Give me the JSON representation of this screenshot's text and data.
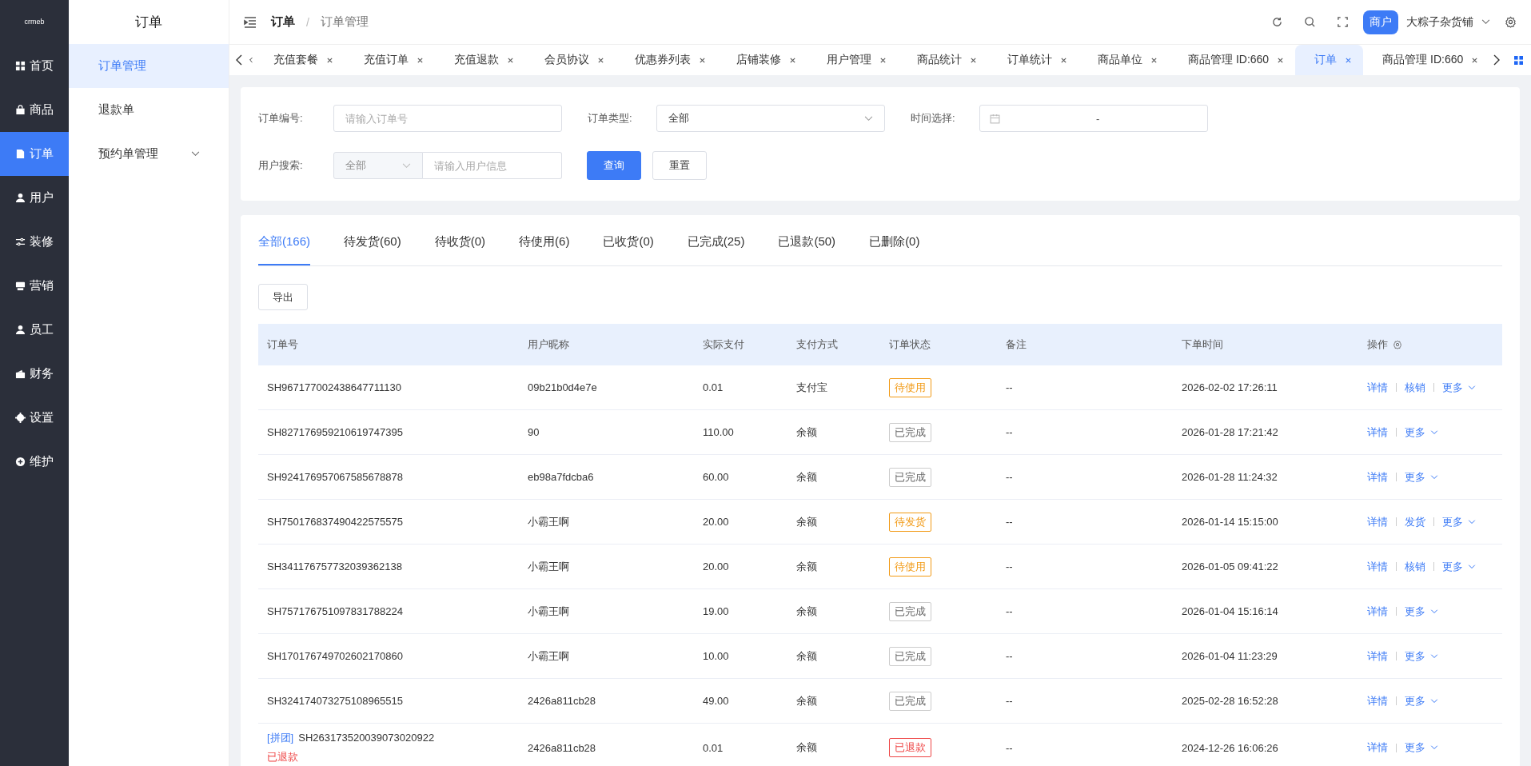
{
  "logo": "crmeb",
  "nav": [
    {
      "label": "首页",
      "selected": false
    },
    {
      "label": "商品",
      "selected": false
    },
    {
      "label": "订单",
      "selected": true
    },
    {
      "label": "用户",
      "selected": false
    },
    {
      "label": "装修",
      "selected": false
    },
    {
      "label": "营销",
      "selected": false
    },
    {
      "label": "员工",
      "selected": false
    },
    {
      "label": "财务",
      "selected": false
    },
    {
      "label": "设置",
      "selected": false
    },
    {
      "label": "维护",
      "selected": false
    }
  ],
  "submenu": {
    "title": "订单",
    "items": [
      {
        "label": "订单管理",
        "selected": true,
        "expandable": false
      },
      {
        "label": "退款单",
        "selected": false,
        "expandable": false
      },
      {
        "label": "预约单管理",
        "selected": false,
        "expandable": true
      }
    ]
  },
  "breadcrumb": [
    "订单",
    "订单管理"
  ],
  "breadcrumb_separator": "/",
  "header": {
    "role_badge": "商户",
    "shop": "大粽子杂货铺"
  },
  "page_tabs": [
    {
      "label": "充值套餐",
      "selected": false
    },
    {
      "label": "充值订单",
      "selected": false
    },
    {
      "label": "充值退款",
      "selected": false
    },
    {
      "label": "会员协议",
      "selected": false
    },
    {
      "label": "优惠券列表",
      "selected": false
    },
    {
      "label": "店铺装修",
      "selected": false
    },
    {
      "label": "用户管理",
      "selected": false
    },
    {
      "label": "商品统计",
      "selected": false
    },
    {
      "label": "订单统计",
      "selected": false
    },
    {
      "label": "商品单位",
      "selected": false
    },
    {
      "label": "商品管理 ID:660",
      "selected": false
    },
    {
      "label": "订单",
      "selected": true
    },
    {
      "label": "商品管理 ID:660",
      "selected": false
    }
  ],
  "filters": {
    "order_no": {
      "label": "订单编号:",
      "placeholder": "请输入订单号"
    },
    "order_type": {
      "label": "订单类型:",
      "value": "全部"
    },
    "time": {
      "label": "时间选择:",
      "separator": "-"
    },
    "user": {
      "label": "用户搜索:",
      "select": "全部",
      "placeholder": "请输入用户信息"
    },
    "search_button": "查询",
    "reset_button": "重置"
  },
  "status_tabs": [
    {
      "label": "全部(166)",
      "selected": true
    },
    {
      "label": "待发货(60)",
      "selected": false
    },
    {
      "label": "待收货(0)",
      "selected": false
    },
    {
      "label": "待使用(6)",
      "selected": false
    },
    {
      "label": "已收货(0)",
      "selected": false
    },
    {
      "label": "已完成(25)",
      "selected": false
    },
    {
      "label": "已退款(50)",
      "selected": false
    },
    {
      "label": "已删除(0)",
      "selected": false
    }
  ],
  "export_button": "导出",
  "table": {
    "columns": [
      "订单号",
      "用户昵称",
      "实际支付",
      "支付方式",
      "订单状态",
      "备注",
      "下单时间",
      "操作"
    ],
    "rows": [
      {
        "order_no": "SH967177002438647711130",
        "user": "09b21b0d4e7e",
        "paid": "0.01",
        "method": "支付宝",
        "status": {
          "label": "待使用",
          "kind": "pending"
        },
        "note": "--",
        "time": "2026-02-02 17:26:11",
        "actions": [
          "详情",
          "核销",
          "更多"
        ]
      },
      {
        "order_no": "SH827176959210619747395",
        "user": "90",
        "paid": "110.00",
        "method": "余额",
        "status": {
          "label": "已完成",
          "kind": "done"
        },
        "note": "--",
        "time": "2026-01-28 17:21:42",
        "actions": [
          "详情",
          "更多"
        ]
      },
      {
        "order_no": "SH924176957067585678878",
        "user": "eb98a7fdcba6",
        "paid": "60.00",
        "method": "余额",
        "status": {
          "label": "已完成",
          "kind": "done"
        },
        "note": "--",
        "time": "2026-01-28 11:24:32",
        "actions": [
          "详情",
          "更多"
        ]
      },
      {
        "order_no": "SH750176837490422575575",
        "user": "小霸王啊",
        "paid": "20.00",
        "method": "余额",
        "status": {
          "label": "待发货",
          "kind": "pending"
        },
        "note": "--",
        "time": "2026-01-14 15:15:00",
        "actions": [
          "详情",
          "发货",
          "更多"
        ]
      },
      {
        "order_no": "SH341176757732039362138",
        "user": "小霸王啊",
        "paid": "20.00",
        "method": "余额",
        "status": {
          "label": "待使用",
          "kind": "pending"
        },
        "note": "--",
        "time": "2026-01-05 09:41:22",
        "actions": [
          "详情",
          "核销",
          "更多"
        ]
      },
      {
        "order_no": "SH757176751097831788224",
        "user": "小霸王啊",
        "paid": "19.00",
        "method": "余额",
        "status": {
          "label": "已完成",
          "kind": "done"
        },
        "note": "--",
        "time": "2026-01-04 15:16:14",
        "actions": [
          "详情",
          "更多"
        ]
      },
      {
        "order_no": "SH170176749702602170860",
        "user": "小霸王啊",
        "paid": "10.00",
        "method": "余额",
        "status": {
          "label": "已完成",
          "kind": "done"
        },
        "note": "--",
        "time": "2026-01-04 11:23:29",
        "actions": [
          "详情",
          "更多"
        ]
      },
      {
        "order_no": "SH324174073275108965515",
        "user": "2426a811cb28",
        "paid": "49.00",
        "method": "余额",
        "status": {
          "label": "已完成",
          "kind": "done"
        },
        "note": "--",
        "time": "2025-02-28 16:52:28",
        "actions": [
          "详情",
          "更多"
        ]
      },
      {
        "tag": "[拼团]",
        "order_no": "SH263173520039073020922",
        "sub_status": "已退款",
        "user": "2426a811cb28",
        "paid": "0.01",
        "method": "余额",
        "status": {
          "label": "已退款",
          "kind": "refunded"
        },
        "note": "--",
        "time": "2024-12-26 16:06:26",
        "actions": [
          "详情",
          "更多"
        ]
      }
    ]
  }
}
